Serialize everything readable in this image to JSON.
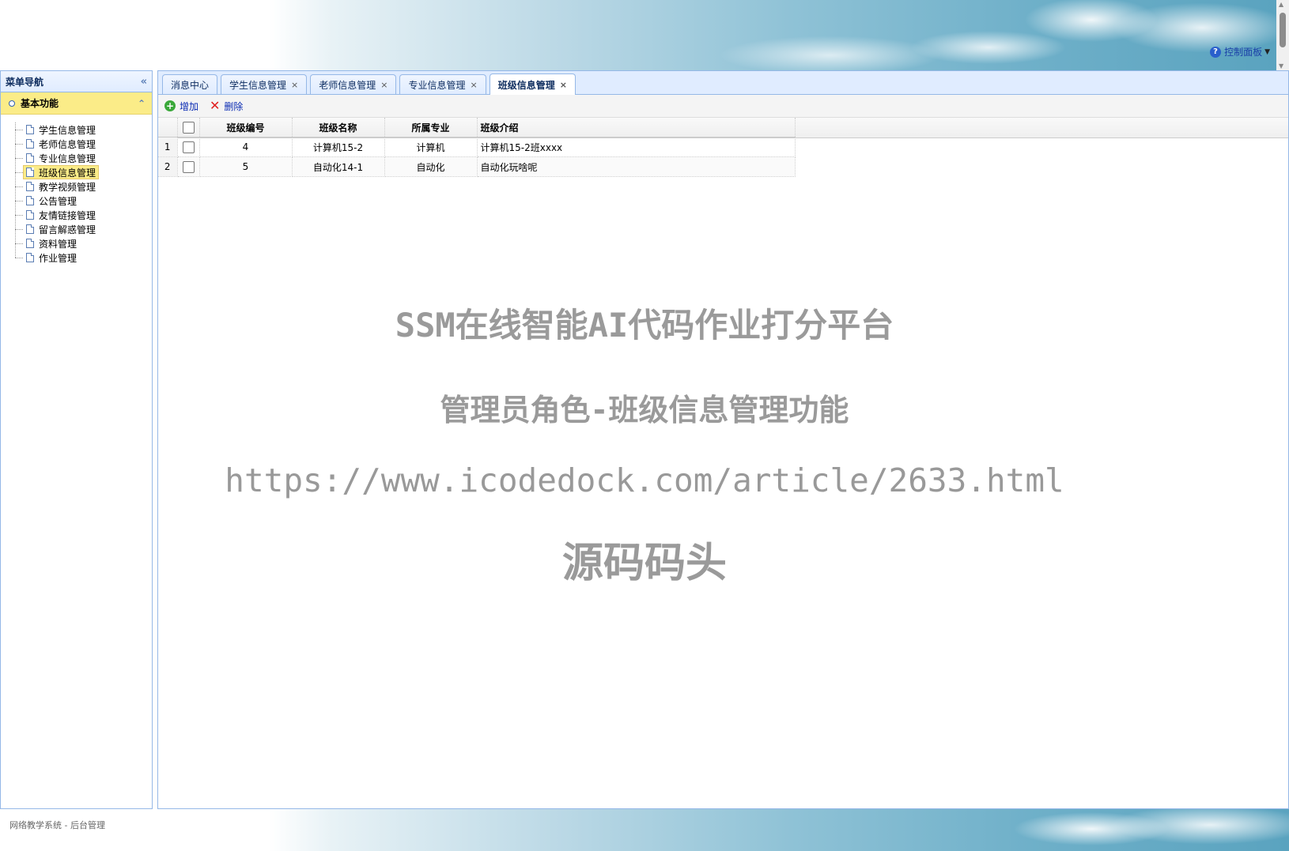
{
  "header": {
    "control_panel_label": "控制面板"
  },
  "sidebar": {
    "title": "菜单导航",
    "section_title": "基本功能",
    "items": [
      {
        "label": "学生信息管理",
        "active": false
      },
      {
        "label": "老师信息管理",
        "active": false
      },
      {
        "label": "专业信息管理",
        "active": false
      },
      {
        "label": "班级信息管理",
        "active": true
      },
      {
        "label": "教学视频管理",
        "active": false
      },
      {
        "label": "公告管理",
        "active": false
      },
      {
        "label": "友情链接管理",
        "active": false
      },
      {
        "label": "留言解惑管理",
        "active": false
      },
      {
        "label": "资料管理",
        "active": false
      },
      {
        "label": "作业管理",
        "active": false
      }
    ]
  },
  "tabs": [
    {
      "label": "消息中心",
      "closable": false,
      "selected": false
    },
    {
      "label": "学生信息管理",
      "closable": true,
      "selected": false
    },
    {
      "label": "老师信息管理",
      "closable": true,
      "selected": false
    },
    {
      "label": "专业信息管理",
      "closable": true,
      "selected": false
    },
    {
      "label": "班级信息管理",
      "closable": true,
      "selected": true
    }
  ],
  "toolbar": {
    "add_label": "增加",
    "delete_label": "删除"
  },
  "grid": {
    "columns": [
      "班级编号",
      "班级名称",
      "所属专业",
      "班级介绍"
    ],
    "rows": [
      {
        "num": "1",
        "id": "4",
        "name": "计算机15-2",
        "major": "计算机",
        "intro": "计算机15-2班xxxx"
      },
      {
        "num": "2",
        "id": "5",
        "name": "自动化14-1",
        "major": "自动化",
        "intro": "自动化玩啥呢"
      }
    ]
  },
  "watermark": {
    "line1": "SSM在线智能AI代码作业打分平台",
    "line2": "管理员角色-班级信息管理功能",
    "line3": "https://www.icodedock.com/article/2633.html",
    "line4": "源码码头"
  },
  "footer": {
    "text": "网络教学系统 - 后台管理"
  }
}
